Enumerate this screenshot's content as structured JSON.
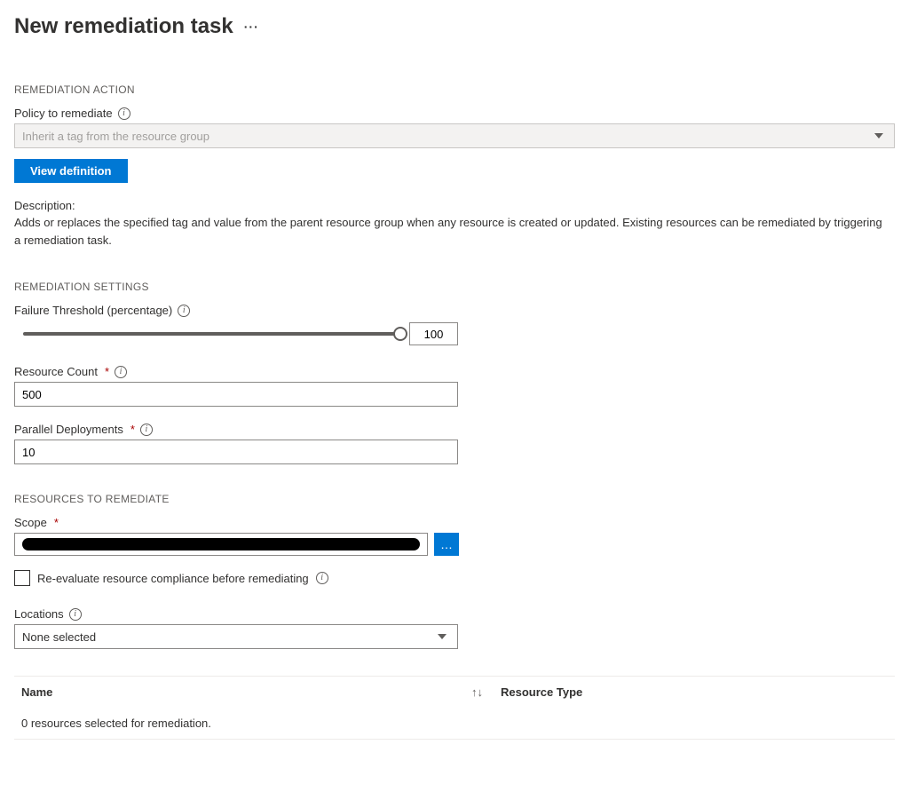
{
  "page": {
    "title": "New remediation task"
  },
  "remediationAction": {
    "heading": "REMEDIATION ACTION",
    "policyLabel": "Policy to remediate",
    "policyValue": "Inherit a tag from the resource group",
    "viewDefinitionBtn": "View definition",
    "descriptionLabel": "Description:",
    "descriptionText": "Adds or replaces the specified tag and value from the parent resource group when any resource is created or updated. Existing resources can be remediated by triggering a remediation task."
  },
  "remediationSettings": {
    "heading": "REMEDIATION SETTINGS",
    "failureThresholdLabel": "Failure Threshold (percentage)",
    "failureThresholdValue": "100",
    "resourceCountLabel": "Resource Count",
    "resourceCountValue": "500",
    "parallelDeploymentsLabel": "Parallel Deployments",
    "parallelDeploymentsValue": "10"
  },
  "resourcesToRemediate": {
    "heading": "RESOURCES TO REMEDIATE",
    "scopeLabel": "Scope",
    "reevaluateLabel": "Re-evaluate resource compliance before remediating",
    "locationsLabel": "Locations",
    "locationsValue": "None selected"
  },
  "table": {
    "colName": "Name",
    "colType": "Resource Type",
    "emptyMessage": "0 resources selected for remediation."
  }
}
